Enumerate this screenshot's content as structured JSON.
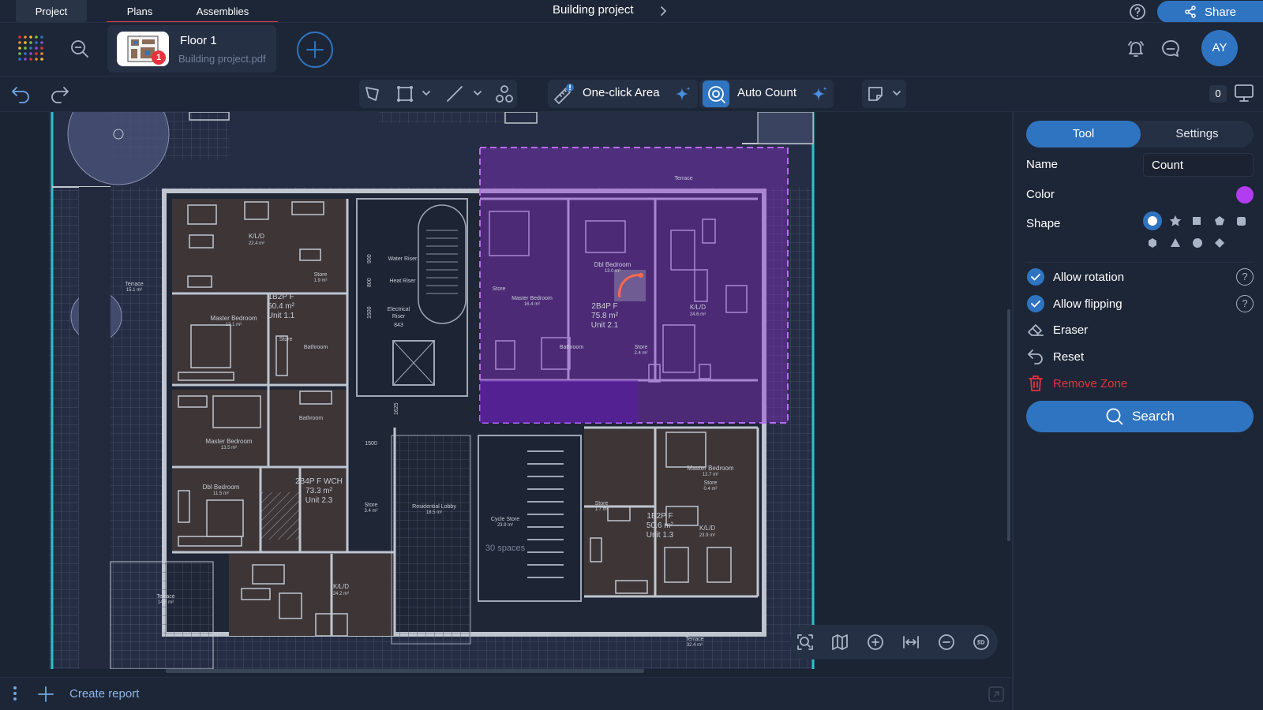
{
  "top_tabs": [
    "Project",
    "Plans",
    "Assemblies"
  ],
  "project_title": "Building project",
  "share_label": "Share",
  "file": {
    "name": "Floor 1",
    "filename": "Building project.pdf",
    "badge": "1"
  },
  "avatar_initials": "AY",
  "toolbar": {
    "one_click_area": "One-click Area",
    "auto_count": "Auto Count",
    "count": "0"
  },
  "panel": {
    "tabs": [
      "Tool",
      "Settings"
    ],
    "name_label": "Name",
    "name_value": "Count",
    "color_label": "Color",
    "color": "#b23cf0",
    "shape_label": "Shape",
    "allow_rotation": "Allow rotation",
    "allow_flipping": "Allow flipping",
    "eraser": "Eraser",
    "reset": "Reset",
    "remove_zone": "Remove Zone",
    "search": "Search"
  },
  "create_report": "Create report",
  "plan_labels": {
    "kld_1": "K/L/D",
    "kld_1_area": "22.4 m²",
    "store_1": "Store",
    "store_1_area": "1.9 m²",
    "terrace_1": "Terrace",
    "terrace_1_area": "15.1 m²",
    "unit_11": "1B2P F",
    "unit_11_area": "50.4 m²",
    "unit_11_name": "Unit 1.1",
    "master_1": "Master Bedroom",
    "master_1_area": "13.1 m²",
    "store_2": "Store",
    "bathroom_1": "Bathroom",
    "water_riser": "Water Riser",
    "heat_riser": "Heat Riser",
    "electrical_riser": "Electrical",
    "electrical_riser_2": "Riser",
    "dim_900": "900",
    "dim_800": "800",
    "dim_1500": "1500",
    "dim_843": "843",
    "dim_1625": "1625",
    "dim_1500b": "1500",
    "terrace_top": "Terrace",
    "dbl_bedroom_1": "Dbl Bedroom",
    "dbl_bedroom_1_area": "13.0 m²",
    "unit_21": "2B4P F",
    "unit_21_area": "75.8 m²",
    "unit_21_name": "Unit 2.1",
    "master_2": "Master Bedroom",
    "master_2_area": "16.4 m²",
    "kld_2": "K/L/D",
    "kld_2_area": "24.6 m²",
    "store_3": "Store",
    "store_3_area": "2.4 m²",
    "bathroom_2": "Bathroom",
    "store_top": "Store",
    "master_3": "Master Bedroom",
    "master_3_area": "13.5 m²",
    "bathroom_3": "Bathroom",
    "dbl_bedroom_2": "Dbl Bedroom",
    "dbl_bedroom_2_area": "11.5 m²",
    "unit_23": "2B4P F WCH",
    "unit_23_area": "73.3 m²",
    "unit_23_name": "Unit 2.3",
    "store_4": "Store",
    "store_4_area": "3.4 m²",
    "lobby": "Residential Lobby",
    "lobby_area": "18.5 m²",
    "cycle": "Cycle Store",
    "cycle_area": "23.9 m²",
    "cycle_spaces": "30 spaces",
    "terrace_2": "Terrace",
    "terrace_2_area": "14.6 m²",
    "kld_3": "K/L/D",
    "kld_3_area": "24.2 m²",
    "master_4": "Master Bedroom",
    "master_4_area": "12.7 m²",
    "store_5": "Store",
    "store_5_area": "0.4 m²",
    "store_6": "Store",
    "store_6_area": "1.7 m²",
    "unit_13": "1B2P F",
    "unit_13_area": "50.6 m²",
    "unit_13_name": "Unit 1.3",
    "kld_4": "K/L/D",
    "kld_4_area": "23.9 m²",
    "terrace_3": "Terrace",
    "terrace_3_area": "32.4 m²"
  }
}
